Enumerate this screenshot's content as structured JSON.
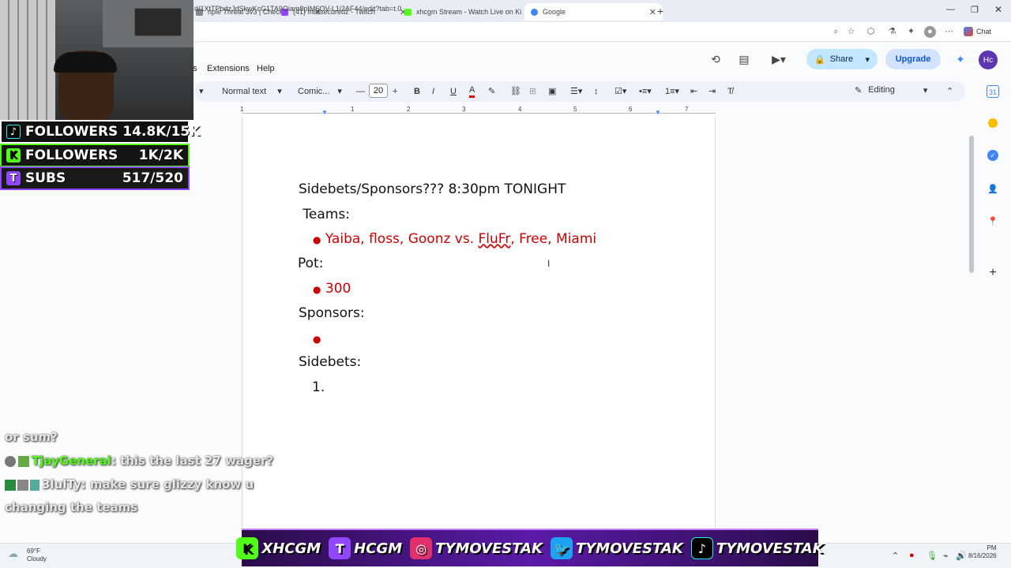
{
  "browser": {
    "tabs": [
      {
        "label": "riple Threat 3v3 | Check",
        "color": "#888888"
      },
      {
        "label": "(41) freesecuredz - Twitch",
        "color": "#9146ff"
      },
      {
        "label": "xhcgm Stream - Watch Live on Ki",
        "color": "#53fc18"
      },
      {
        "label": "Google",
        "color": "#4285f4"
      }
    ],
    "url": "d/1XtTPbdzJdSkwKcG1TA9Oiam8pIM6OV-L1i2AF44/edit?tab=t.0",
    "chat_label": "Chat"
  },
  "docs": {
    "menus": [
      "s",
      "Extensions",
      "Help"
    ],
    "share_label": "Share",
    "upgrade_label": "Upgrade",
    "avatar_initials": "Hc",
    "toolbar": {
      "style": "Normal text",
      "font": "Comic...",
      "font_size": "20",
      "mode": "Editing"
    },
    "ruler_ticks": [
      "1",
      "1",
      "2",
      "3",
      "4",
      "5",
      "6",
      "7"
    ]
  },
  "document": {
    "title_line": "Sidebets/Sponsors??? 8:30pm TONIGHT",
    "teams_label": " Teams:",
    "teams_bullet_a": "Yaiba, floss, Goonz vs. ",
    "teams_bullet_misspelled": "FluFr",
    "teams_bullet_b": ", Free, Miami",
    "pot_label": "Pot:",
    "pot_value": "300",
    "sponsors_label": "Sponsors:",
    "sidebets_label": "Sidebets:",
    "sidebets_item_1": "1.",
    "bullet_glyph": "●",
    "text_color": "#cc0000"
  },
  "overlay": {
    "stats": [
      {
        "label": "FOLLOWERS",
        "value": "14.8K/15K",
        "bg": "#111111",
        "icon": "tiktok-icon"
      },
      {
        "label": "FOLLOWERS",
        "value": "1K/2K",
        "bg": "#1a1a1a",
        "icon": "kick-icon"
      },
      {
        "label": "SUBS",
        "value": "517/520",
        "bg": "#1e1e1e",
        "icon": "twitch-icon"
      }
    ],
    "chat": [
      {
        "user": "",
        "text": "or sum?"
      },
      {
        "user": "TjayGeneral",
        "text": ": this the last 27 wager?"
      },
      {
        "user": "3lulTy",
        "text": ": make sure glizzy know u"
      },
      {
        "user": "",
        "text": "changing the teams"
      }
    ],
    "banner": [
      {
        "icon": "kick-icon",
        "glyph": "K",
        "text": "XHCGM",
        "color": "#53fc18"
      },
      {
        "icon": "twitch-icon",
        "glyph": "T",
        "text": "HCGM",
        "color": "#9146ff"
      },
      {
        "icon": "instagram-icon",
        "glyph": "◎",
        "text": "TYMOVESTAK",
        "color": "#e1306c"
      },
      {
        "icon": "twitter-icon",
        "glyph": "🐦",
        "text": "TYMOVESTAK",
        "color": "#1da1f2"
      },
      {
        "icon": "tiktok-icon",
        "glyph": "♪",
        "text": "TYMOVESTAK",
        "color": "#000000"
      }
    ]
  },
  "taskbar": {
    "temp": "69°F",
    "condition": "Cloudy",
    "time": "PM",
    "date": "8/16/2026"
  }
}
